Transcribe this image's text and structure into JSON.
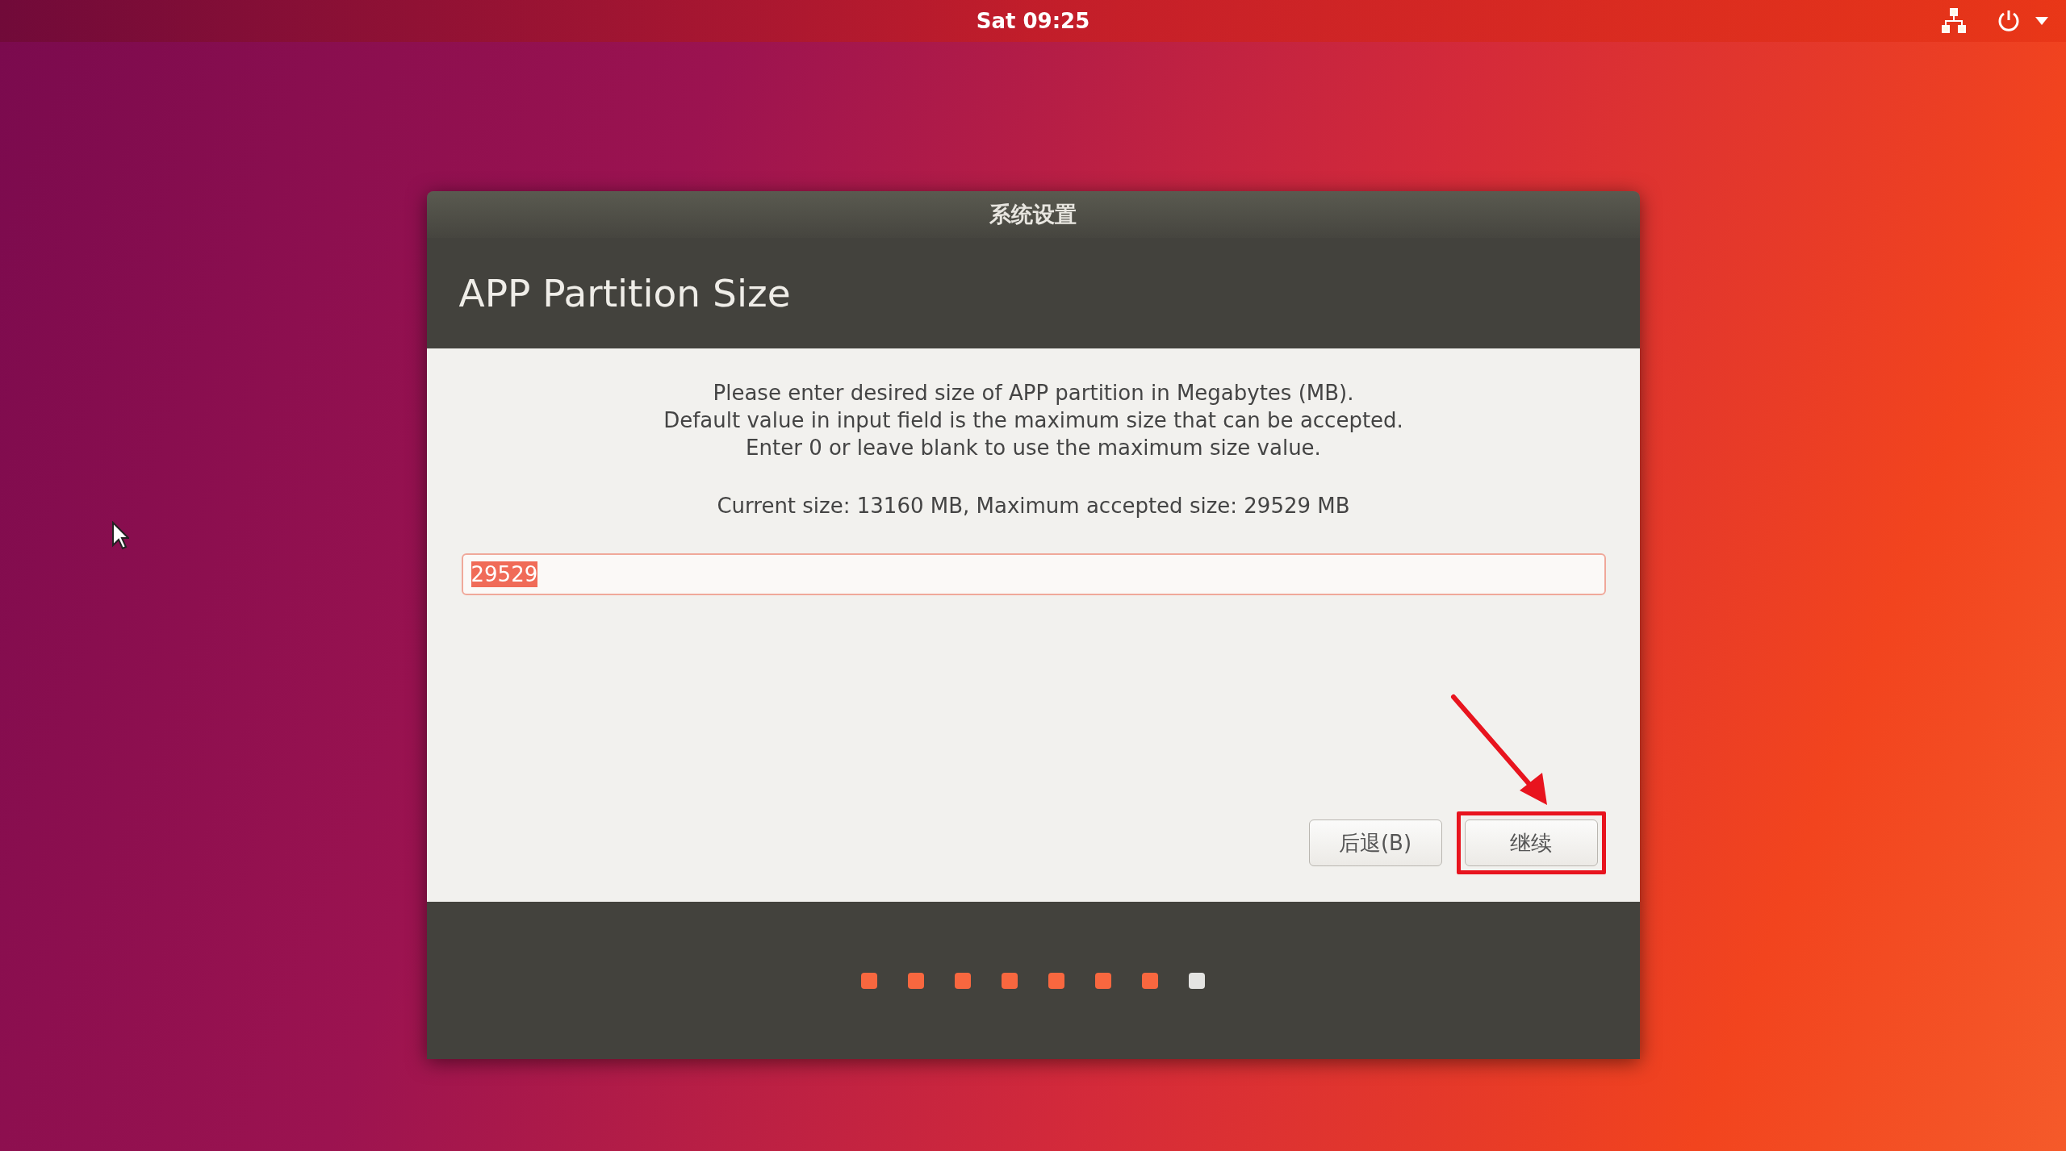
{
  "top_bar": {
    "clock": "Sat 09:25"
  },
  "dialog": {
    "window_title": "系统设置",
    "heading": "APP Partition Size",
    "instructions": [
      "Please enter desired size of APP partition in Megabytes (MB).",
      "Default value in input field is the maximum size that can be accepted.",
      "Enter 0 or leave blank to use the maximum size value."
    ],
    "size_info": "Current size: 13160 MB, Maximum accepted size: 29529 MB",
    "size_input": {
      "value": "29529",
      "text_selected": true
    },
    "buttons": [
      {
        "label": "后退(B)",
        "highlighted": false
      },
      {
        "label": "继续",
        "highlighted": true
      }
    ],
    "progress_steps": [
      {
        "done": true
      },
      {
        "done": true
      },
      {
        "done": true
      },
      {
        "done": true
      },
      {
        "done": true
      },
      {
        "done": true
      },
      {
        "done": true
      },
      {
        "done": false
      }
    ]
  }
}
